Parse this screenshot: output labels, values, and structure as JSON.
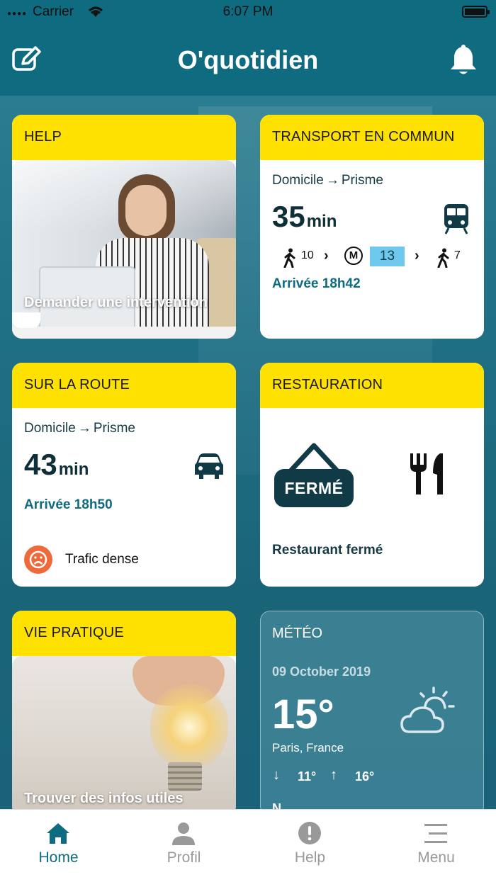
{
  "status": {
    "carrier": "Carrier",
    "time": "6:07 PM"
  },
  "header": {
    "title": "O'quotidien"
  },
  "help": {
    "title": "HELP",
    "caption": "Demander une intervention"
  },
  "transport": {
    "title": "TRANSPORT EN COMMUN",
    "from": "Domicile",
    "to": "Prisme",
    "duration": "35",
    "unit": "min",
    "walk1": "10",
    "metro_letter": "M",
    "line": "13",
    "walk2": "7",
    "arrival": "Arrivée 18h42",
    "accent": "#6ec7ec"
  },
  "route": {
    "title": "SUR LA ROUTE",
    "from": "Domicile",
    "to": "Prisme",
    "duration": "43",
    "unit": "min",
    "arrival": "Arrivée 18h50",
    "traffic": "Trafic dense",
    "traffic_color": "#ef6a3b"
  },
  "restauration": {
    "title": "RESTAURATION",
    "sign": "FERMÉ",
    "status": "Restaurant fermé"
  },
  "vie": {
    "title": "VIE PRATIQUE",
    "caption": "Trouver des infos utiles"
  },
  "meteo": {
    "title": "MÉTÉO",
    "date": "09 October 2019",
    "temp": "15°",
    "location": "Paris, France",
    "min": "11°",
    "max": "16°",
    "cut_text": "N"
  },
  "tabs": [
    {
      "label": "Home",
      "icon": "home-icon"
    },
    {
      "label": "Profil",
      "icon": "user-icon"
    },
    {
      "label": "Help",
      "icon": "alert-icon"
    },
    {
      "label": "Menu",
      "icon": "menu-icon"
    }
  ],
  "colors": {
    "primary": "#0f6b80",
    "yellow": "#ffe100"
  }
}
